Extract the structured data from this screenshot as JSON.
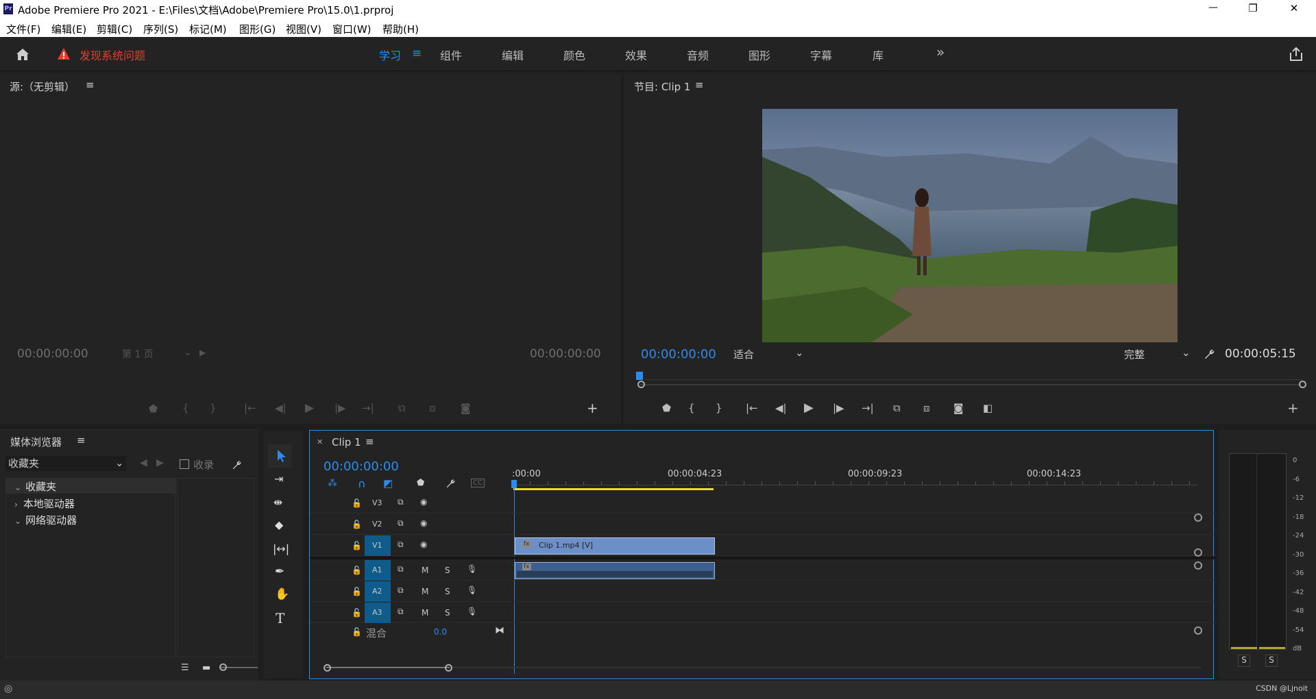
{
  "window": {
    "app_icon": "Pr",
    "title": "Adobe Premiere Pro 2021 - E:\\Files\\文档\\Adobe\\Premiere Pro\\15.0\\1.prproj",
    "controls": {
      "minimize": "—",
      "restore": "❐",
      "close": "✕"
    }
  },
  "menu": [
    "文件(F)",
    "编辑(E)",
    "剪辑(C)",
    "序列(S)",
    "标记(M)",
    "图形(G)",
    "视图(V)",
    "窗口(W)",
    "帮助(H)"
  ],
  "workspace": {
    "warning": "发现系统问题",
    "tabs": [
      "学习",
      "组件",
      "编辑",
      "颜色",
      "效果",
      "音频",
      "图形",
      "字幕",
      "库"
    ],
    "active_tab": "学习",
    "more": "»"
  },
  "source": {
    "title": "源:（无剪辑）",
    "tc_left": "00:00:00:00",
    "tc_right": "00:00:00:00",
    "page": "第 1 页"
  },
  "program": {
    "title": "节目: Clip 1",
    "tc": "00:00:00:00",
    "fit": "适合",
    "quality": "完整",
    "duration": "00:00:05:15"
  },
  "media_browser": {
    "title": "媒体浏览器",
    "location": "收藏夹",
    "ingest": "收录",
    "tree": [
      {
        "label": "收藏夹",
        "expanded": true
      },
      {
        "label": "本地驱动器",
        "expanded": false
      },
      {
        "label": "网络驱动器",
        "expanded": true
      }
    ]
  },
  "timeline": {
    "tab": "Clip 1",
    "tc": "00:00:00:00",
    "ruler": [
      ":00:00",
      "00:00:04:23",
      "00:00:09:23",
      "00:00:14:23"
    ],
    "tracks": [
      {
        "name": "V3",
        "type": "video"
      },
      {
        "name": "V2",
        "type": "video"
      },
      {
        "name": "V1",
        "type": "video"
      },
      {
        "name": "A1",
        "type": "audio"
      },
      {
        "name": "A2",
        "type": "audio"
      },
      {
        "name": "A3",
        "type": "audio"
      }
    ],
    "mix_label": "混合",
    "mix_value": "0.0",
    "clip_video": "Clip 1.mp4 [V]",
    "clip_fx": "fx",
    "mute": "M",
    "solo": "S"
  },
  "audio_meter": {
    "scale": [
      "0",
      "-6",
      "-12",
      "-18",
      "-24",
      "-30",
      "-36",
      "-42",
      "-48",
      "-54",
      "dB"
    ],
    "solo_left": "S",
    "solo_right": "S"
  },
  "status": {
    "watermark": "CSDN @Ljnoit"
  },
  "colors": {
    "accent_blue": "#2d8ceb",
    "track_blue": "#0f5b8a",
    "warning_red": "#e0402f",
    "clip_video": "#6d8fc7",
    "clip_audio": "#3d5f8f",
    "playhead": "#2d8ceb",
    "work_area": "#e8e020"
  }
}
